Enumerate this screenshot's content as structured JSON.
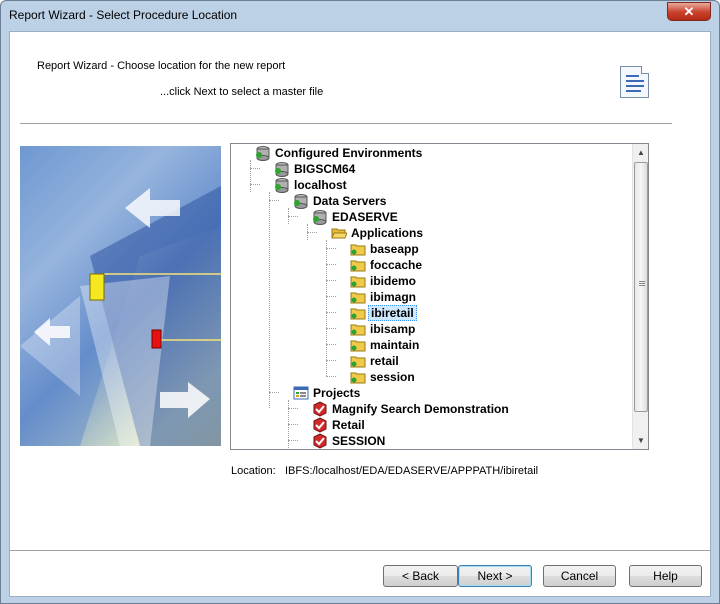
{
  "window": {
    "title": "Report Wizard - Select Procedure Location",
    "close_glyph": "✕"
  },
  "header": {
    "heading": "Report Wizard - Choose location for the new report",
    "subheading": "...click Next to select a master file",
    "icon": "report-document-icon"
  },
  "tree": {
    "nodes": [
      {
        "label": "Configured Environments",
        "icon": "environment-icon"
      },
      {
        "label": "BIGSCM64",
        "icon": "server-icon"
      },
      {
        "label": "localhost",
        "icon": "server-icon"
      },
      {
        "label": "Data Servers",
        "icon": "data-servers-icon"
      },
      {
        "label": "EDASERVE",
        "icon": "server-icon"
      },
      {
        "label": "Applications",
        "icon": "folder-open-icon"
      },
      {
        "label": "baseapp",
        "icon": "folder-icon"
      },
      {
        "label": "foccache",
        "icon": "folder-icon"
      },
      {
        "label": "ibidemo",
        "icon": "folder-icon"
      },
      {
        "label": "ibimagn",
        "icon": "folder-icon"
      },
      {
        "label": "ibiretail",
        "icon": "folder-icon",
        "selected": true
      },
      {
        "label": "ibisamp",
        "icon": "folder-icon"
      },
      {
        "label": "maintain",
        "icon": "folder-icon"
      },
      {
        "label": "retail",
        "icon": "folder-icon"
      },
      {
        "label": "session",
        "icon": "folder-icon"
      },
      {
        "label": "Projects",
        "icon": "projects-icon"
      },
      {
        "label": "Magnify Search Demonstration",
        "icon": "project-check-icon"
      },
      {
        "label": "Retail",
        "icon": "project-check-icon"
      },
      {
        "label": "SESSION",
        "icon": "project-check-icon"
      }
    ],
    "scroll_up": "▲",
    "scroll_down": "▼"
  },
  "location": {
    "label": "Location:",
    "value": "IBFS:/localhost/EDA/EDASERVE/APPPATH/ibiretail"
  },
  "buttons": {
    "back": "< Back",
    "next": "Next >",
    "cancel": "Cancel",
    "help": "Help"
  },
  "colors": {
    "selection": "#cde8ff",
    "folder": "#f2c94c",
    "accent": "#3c7fb1"
  }
}
